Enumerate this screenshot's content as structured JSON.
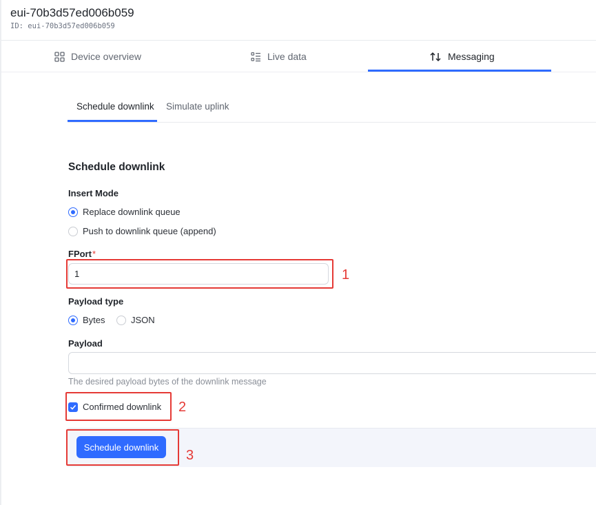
{
  "device": {
    "title": "eui-70b3d57ed006b059",
    "id_label": "ID:",
    "id_value": "eui-70b3d57ed006b059"
  },
  "main_tabs": [
    {
      "label": "Device overview",
      "icon": "grid-icon",
      "active": false
    },
    {
      "label": "Live data",
      "icon": "list-icon",
      "active": false
    },
    {
      "label": "Messaging",
      "icon": "arrows-up-down-icon",
      "active": true
    }
  ],
  "sub_tabs": [
    {
      "label": "Schedule downlink",
      "active": true
    },
    {
      "label": "Simulate uplink",
      "active": false
    }
  ],
  "form": {
    "title": "Schedule downlink",
    "insert_mode": {
      "label": "Insert Mode",
      "options": [
        {
          "label": "Replace downlink queue",
          "checked": true
        },
        {
          "label": "Push to downlink queue (append)",
          "checked": false
        }
      ]
    },
    "fport": {
      "label": "FPort",
      "required_mark": "*",
      "value": "1"
    },
    "payload_type": {
      "label": "Payload type",
      "options": [
        {
          "label": "Bytes",
          "checked": true
        },
        {
          "label": "JSON",
          "checked": false
        }
      ]
    },
    "payload": {
      "label": "Payload",
      "value": "",
      "help": "The desired payload bytes of the downlink message"
    },
    "confirmed": {
      "label": "Confirmed downlink",
      "checked": true
    },
    "submit_label": "Schedule downlink"
  },
  "annotations": [
    "1",
    "2",
    "3"
  ],
  "colors": {
    "accent": "#2f6bff",
    "annotation": "#e53935"
  }
}
